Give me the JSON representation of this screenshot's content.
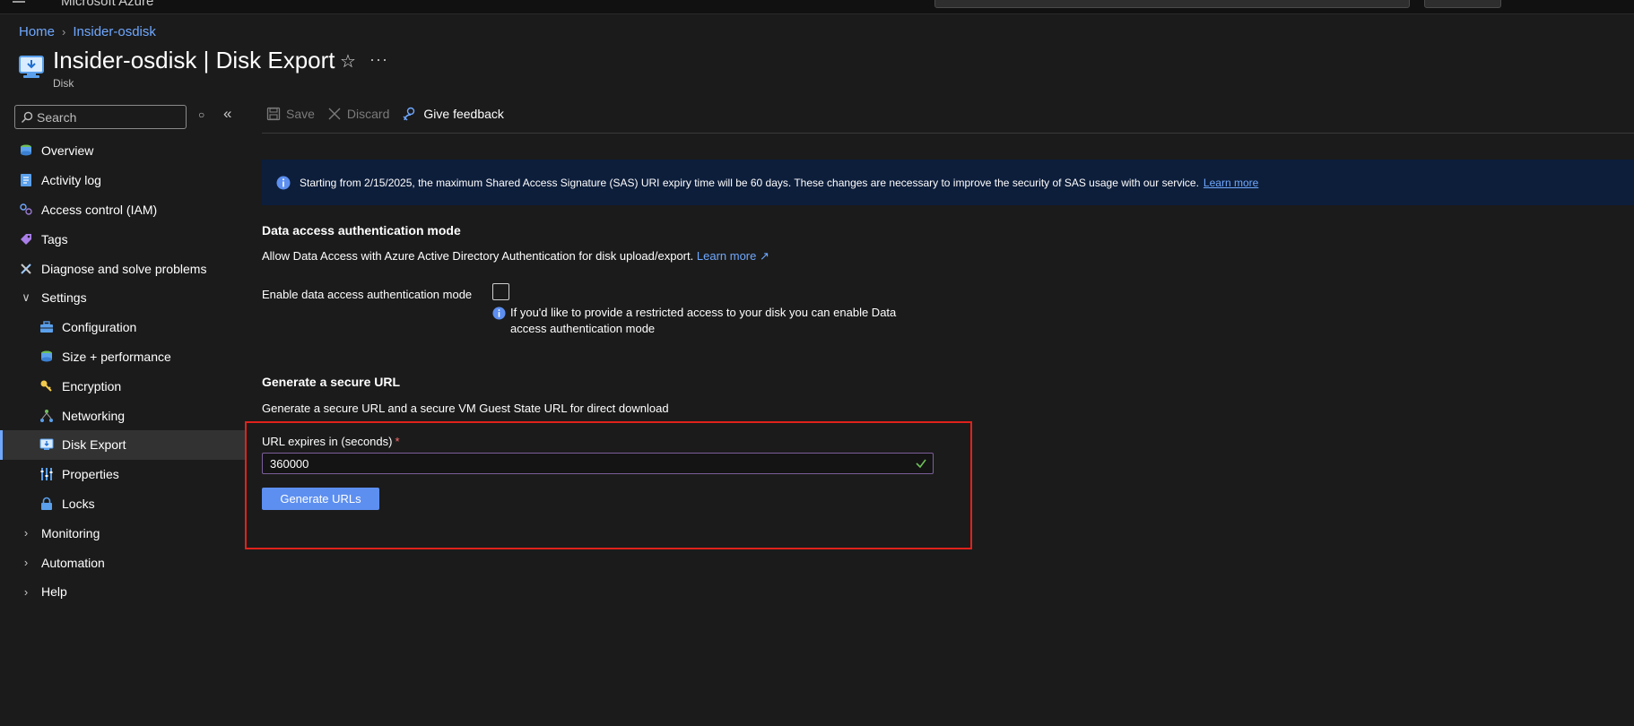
{
  "topbar": {
    "brand": "Microsoft Azure"
  },
  "breadcrumb": {
    "home": "Home",
    "resource": "Insider-osdisk"
  },
  "header": {
    "title": "Insider-osdisk | Disk Export",
    "subtitle": "Disk",
    "more": "···"
  },
  "sidebar": {
    "search_placeholder": "Search",
    "items": [
      {
        "label": "Overview",
        "icon": "overview-icon"
      },
      {
        "label": "Activity log",
        "icon": "activity-log-icon"
      },
      {
        "label": "Access control (IAM)",
        "icon": "iam-icon"
      },
      {
        "label": "Tags",
        "icon": "tag-icon"
      },
      {
        "label": "Diagnose and solve problems",
        "icon": "wrench-icon"
      },
      {
        "label": "Settings",
        "icon": "chevron-down-icon"
      },
      {
        "label": "Configuration",
        "icon": "configuration-icon"
      },
      {
        "label": "Size + performance",
        "icon": "size-icon"
      },
      {
        "label": "Encryption",
        "icon": "key-icon"
      },
      {
        "label": "Networking",
        "icon": "network-icon"
      },
      {
        "label": "Disk Export",
        "icon": "disk-export-icon"
      },
      {
        "label": "Properties",
        "icon": "properties-icon"
      },
      {
        "label": "Locks",
        "icon": "lock-icon"
      },
      {
        "label": "Monitoring",
        "icon": "chevron-right-icon"
      },
      {
        "label": "Automation",
        "icon": "chevron-right-icon"
      },
      {
        "label": "Help",
        "icon": "chevron-right-icon"
      }
    ],
    "active_item": "Disk Export"
  },
  "toolbar": {
    "save": "Save",
    "discard": "Discard",
    "feedback": "Give feedback"
  },
  "banner": {
    "text": "Starting from 2/15/2025, the maximum Shared Access Signature (SAS) URI expiry time will be 60 days. These changes are necessary to improve the security of SAS usage with our service.",
    "link": "Learn more"
  },
  "auth": {
    "title": "Data access authentication mode",
    "desc": "Allow Data Access with Azure Active Directory Authentication for disk upload/export.",
    "learn_more": "Learn more",
    "field_label": "Enable data access authentication mode",
    "checked": false,
    "hint": "If you'd like to provide a restricted access to your disk you can enable Data access authentication mode"
  },
  "url": {
    "title": "Generate a secure URL",
    "desc": "Generate a secure URL and a secure VM Guest State URL for direct download",
    "field_label": "URL expires in (seconds)",
    "required_mark": "*",
    "value": "360000",
    "button": "Generate URLs"
  },
  "colors": {
    "accent": "#6fa8ff",
    "banner_bg": "#0d1e3b",
    "primary_button": "#5d8ff0",
    "highlight_border": "#e0221c"
  }
}
